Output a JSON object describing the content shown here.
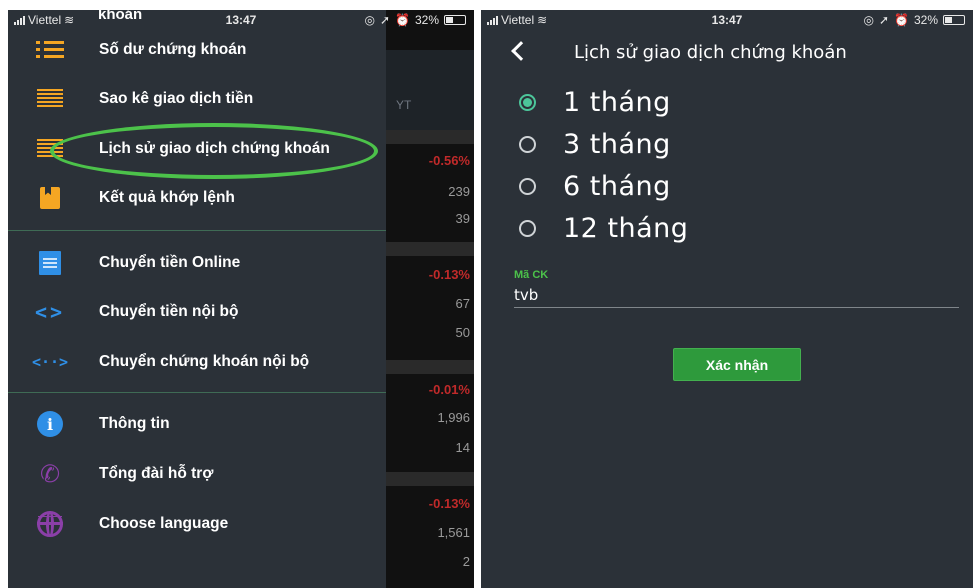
{
  "left_screen": {
    "status_bar": {
      "carrier": "Viettel",
      "time": "13:47",
      "battery": "32%"
    },
    "cut_off_text": "khoán",
    "background_table": {
      "header_label": "YT",
      "rows": [
        {
          "change": "-0.56%",
          "values": [
            "239",
            "39"
          ]
        },
        {
          "change": "-0.13%",
          "values": [
            "67",
            "50"
          ]
        },
        {
          "change": "-0.01%",
          "values": [
            "1,996",
            "14"
          ]
        },
        {
          "change": "-0.13%",
          "values": [
            "1,561",
            "2"
          ]
        }
      ]
    },
    "menu": {
      "items": [
        {
          "label": "Số dư chứng khoán",
          "icon": "list-icon"
        },
        {
          "label": "Sao kê giao dịch tiền",
          "icon": "lines-icon"
        },
        {
          "label": "Lịch sử giao dịch chứng khoán",
          "icon": "lines-icon"
        },
        {
          "label": "Kết quả khớp lệnh",
          "icon": "bookmark-icon"
        },
        {
          "label": "Chuyển tiền Online",
          "icon": "receipt-icon"
        },
        {
          "label": "Chuyển tiền nội bộ",
          "icon": "code-arrows-icon"
        },
        {
          "label": "Chuyển chứng khoán nội bộ",
          "icon": "transfer-arrows-icon"
        },
        {
          "label": "Thông tin",
          "icon": "info-icon"
        },
        {
          "label": "Tổng đài hỗ trợ",
          "icon": "phone-icon"
        },
        {
          "label": "Choose language",
          "icon": "globe-icon"
        }
      ]
    },
    "accent_colors": {
      "icon_orange": "#f5a623",
      "icon_blue": "#2f8fe6",
      "icon_purple": "#8b3fa8",
      "highlight_green": "#4cc24a"
    }
  },
  "right_screen": {
    "status_bar": {
      "carrier": "Viettel",
      "time": "13:47",
      "battery": "32%"
    },
    "title": "Lịch sử giao dịch chứng khoán",
    "period_options": [
      {
        "label": "1 tháng",
        "selected": true
      },
      {
        "label": "3 tháng",
        "selected": false
      },
      {
        "label": "6 tháng",
        "selected": false
      },
      {
        "label": "12 tháng",
        "selected": false
      }
    ],
    "stock_code": {
      "label": "Mã CK",
      "value": "tvb"
    },
    "confirm_label": "Xác nhận",
    "accent_colors": {
      "radio_green": "#4cc69a",
      "button_green": "#2e9a3c"
    }
  }
}
